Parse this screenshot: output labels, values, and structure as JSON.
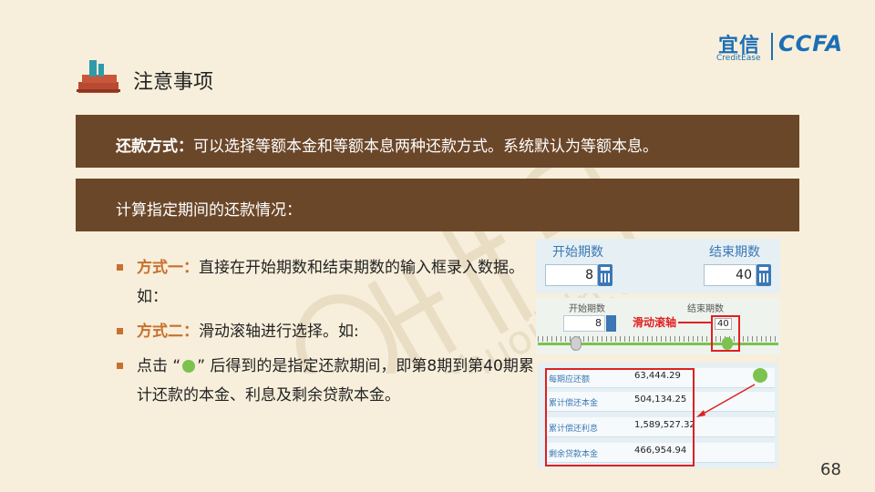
{
  "header": {
    "title": "注意事项",
    "icon": "stacked-books-icon"
  },
  "logo": {
    "brand_cn": "宜信",
    "brand_en": "CreditEase",
    "partner": "CCFA"
  },
  "watermark": {
    "text_cn": "星火金服",
    "text_url": "xinghuojixin.com"
  },
  "banner1": {
    "label": "还款方式：",
    "text": "可以选择等额本金和等额本息两种还款方式。系统默认为等额本息。"
  },
  "banner2": {
    "text": "计算指定期间的还款情况："
  },
  "bullets": [
    {
      "label": "方式一：",
      "text": "直接在开始期数和结束期数的输入框录入数据。如："
    },
    {
      "label": "方式二：",
      "text": "滑动滚轴进行选择。如:"
    },
    {
      "prefix": "点击 “",
      "suffix": "” 后得到的是指定还款期间，即第8期到第40期累计还款的本金、利息及剩余贷款本金。"
    }
  ],
  "panel_input": {
    "start_label": "开始期数",
    "end_label": "结束期数",
    "start_value": "8",
    "end_value": "40"
  },
  "panel_slider": {
    "start_label": "开始期数",
    "end_label": "结束期数",
    "start_value": "8",
    "end_value": "40",
    "slider_label": "滑动滚轴",
    "slider_value": "40"
  },
  "results": [
    {
      "label": "每期应还额",
      "value": "63,444.29"
    },
    {
      "label": "累计偿还本金",
      "value": "504,134.25"
    },
    {
      "label": "累计偿还利息",
      "value": "1,589,527.32"
    },
    {
      "label": "剩余贷款本金",
      "value": "466,954.94"
    }
  ],
  "page_number": "68",
  "colors": {
    "banner": "#6b4729",
    "accent": "#c8702e",
    "brand_blue": "#1b6fb5",
    "highlight_red": "#e02020",
    "green": "#7cc24e"
  }
}
